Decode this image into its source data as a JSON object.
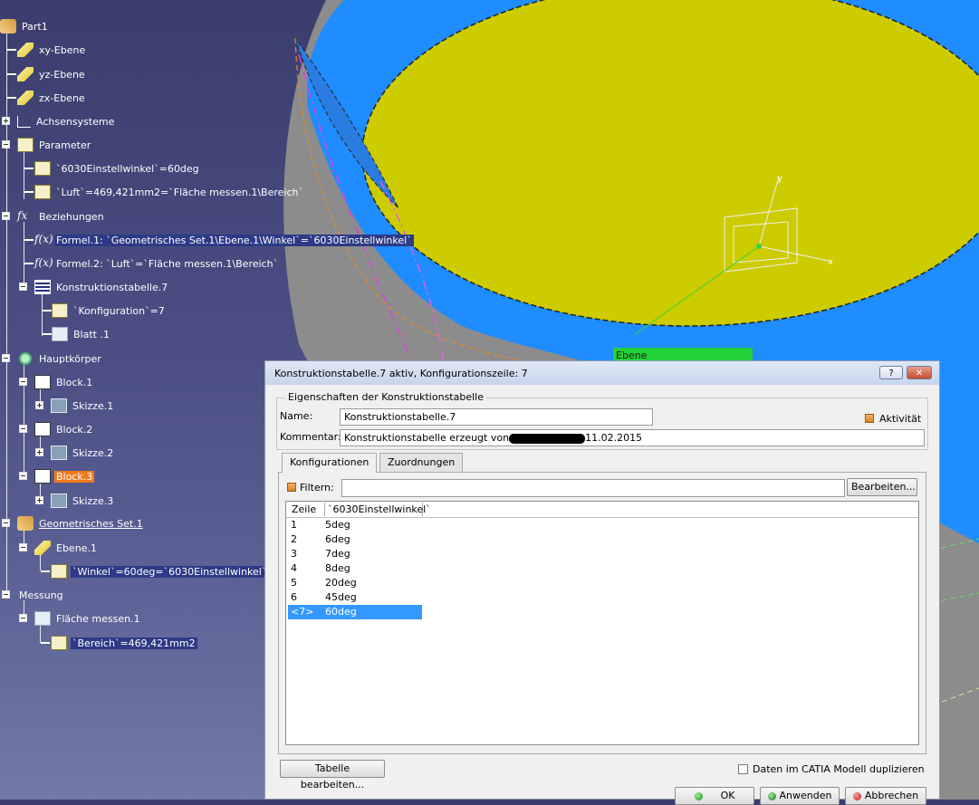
{
  "tree": {
    "items": [
      {
        "label": "Part1"
      },
      {
        "label": "xy-Ebene"
      },
      {
        "label": "yz-Ebene"
      },
      {
        "label": "zx-Ebene"
      },
      {
        "label": "Achsensysteme"
      },
      {
        "label": "Parameter"
      },
      {
        "label": "`6030Einstellwinkel`=60deg"
      },
      {
        "label": "`Luft`=469,421mm2=`Fläche messen.1\\Bereich`"
      },
      {
        "label": "Beziehungen"
      },
      {
        "label": "Formel.1: `Geometrisches Set.1\\Ebene.1\\Winkel`=`6030Einstellwinkel`"
      },
      {
        "label": "Formel.2: `Luft`=`Fläche messen.1\\Bereich`"
      },
      {
        "label": "Konstruktionstabelle.7"
      },
      {
        "label": "`Konfiguration`=7"
      },
      {
        "label": "Blatt .1"
      },
      {
        "label": "Hauptkörper"
      },
      {
        "label": "Block.1"
      },
      {
        "label": "Skizze.1"
      },
      {
        "label": "Block.2"
      },
      {
        "label": "Skizze.2"
      },
      {
        "label": "Block.3"
      },
      {
        "label": "Skizze.3"
      },
      {
        "label": "Geometrisches Set.1"
      },
      {
        "label": "Ebene.1"
      },
      {
        "label": "`Winkel`=60deg=`6030Einstellwinkel`"
      },
      {
        "label": "Messung"
      },
      {
        "label": "Fläche messen.1"
      },
      {
        "label": "`Bereich`=469,421mm2"
      }
    ]
  },
  "viewport": {
    "plane_label": "Ebene",
    "axis_x": "x",
    "axis_y": "y"
  },
  "dialog": {
    "title": "Konstruktionstabelle.7 aktiv, Konfigurationszeile: 7",
    "help_btn": "?",
    "close_btn": "✕",
    "group_label": "Eigenschaften der Konstruktionstabelle",
    "name_label": "Name:",
    "name_value": "Konstruktionstabelle.7",
    "activity_label": "Aktivität",
    "comment_label": "Kommentar:",
    "comment_value_prefix": "Konstruktionstabelle erzeugt von",
    "comment_value_suffix": "11.02.2015",
    "tabs": [
      {
        "label": "Konfigurationen"
      },
      {
        "label": "Zuordnungen"
      }
    ],
    "filter_label": "Filtern:",
    "filter_value": "",
    "edit_filter_btn": "Bearbeiten...",
    "columns": [
      "Zeile",
      "`6030Einstellwinkel`"
    ],
    "rows": [
      {
        "row": "1",
        "value": "5deg"
      },
      {
        "row": "2",
        "value": "6deg"
      },
      {
        "row": "3",
        "value": "7deg"
      },
      {
        "row": "4",
        "value": "8deg"
      },
      {
        "row": "5",
        "value": "20deg"
      },
      {
        "row": "6",
        "value": "45deg"
      },
      {
        "row": "<7>",
        "value": "60deg"
      }
    ],
    "edit_table_btn": "Tabelle bearbeiten...",
    "duplicate_label": "Daten im CATIA Modell duplizieren",
    "ok_btn": "OK",
    "apply_btn": "Anwenden",
    "cancel_btn": "Abbrechen"
  },
  "colors": {
    "tree_highlight": "#2e3a86",
    "tree_selected": "#ef7b1e",
    "list_selected": "#3399ff",
    "plane_label_bg": "#23d23a"
  }
}
